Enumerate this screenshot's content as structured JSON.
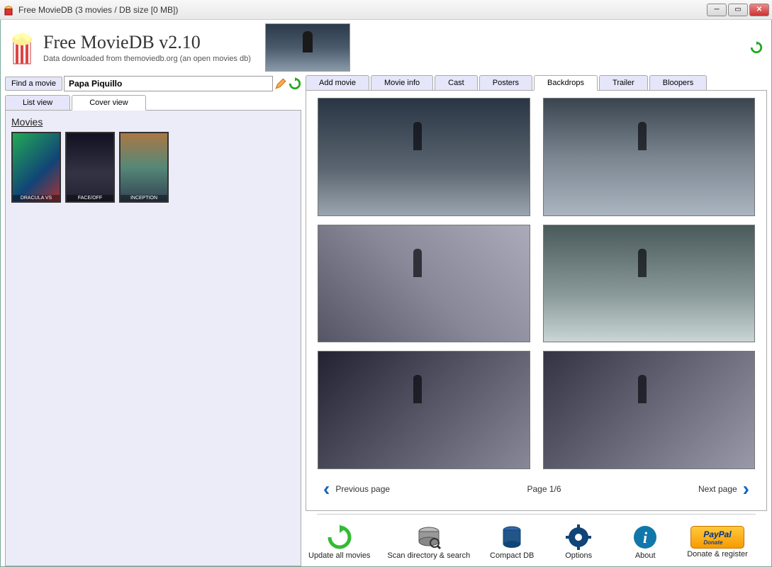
{
  "window": {
    "title": "Free MovieDB (3 movies / DB size [0 MB])"
  },
  "header": {
    "app_title": "Free MovieDB v2.10",
    "subtitle": "Data downloaded from themoviedb.org (an open movies db)"
  },
  "search": {
    "find_label": "Find a movie",
    "value": "Papa Piquillo"
  },
  "view_tabs": {
    "list": "List view",
    "cover": "Cover view",
    "active": "cover"
  },
  "movies": {
    "heading": "Movies",
    "items": [
      {
        "title": "DRACULA VS"
      },
      {
        "title": "FACE/OFF"
      },
      {
        "title": "INCEPTION"
      }
    ]
  },
  "detail_tabs": {
    "items": [
      "Add movie",
      "Movie info",
      "Cast",
      "Posters",
      "Backdrops",
      "Trailer",
      "Bloopers"
    ],
    "active": 4
  },
  "pager": {
    "prev_label": "Previous page",
    "next_label": "Next page",
    "indicator": "Page 1/6"
  },
  "toolbar": {
    "update": "Update all movies",
    "scan": "Scan directory & search",
    "compact": "Compact DB",
    "options": "Options",
    "about": "About",
    "donate": "Donate & register",
    "paypal": "PayPal",
    "paypal_sub": "Donate"
  }
}
